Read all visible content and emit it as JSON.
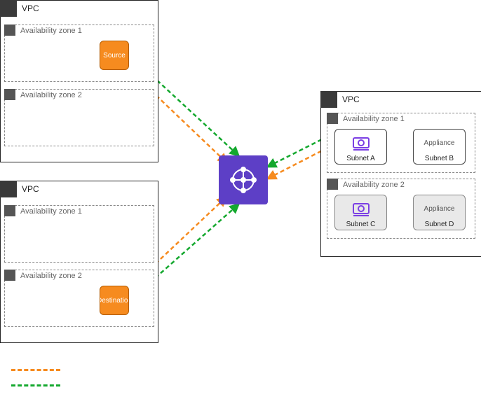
{
  "left_vpc_top": {
    "title": "VPC",
    "az1": "Availability zone 1",
    "az2": "Availability zone 2",
    "source_label": "Source"
  },
  "left_vpc_bottom": {
    "title": "VPC",
    "az1": "Availability zone 1",
    "az2": "Availability zone 2",
    "dest_label": "Destination"
  },
  "right_vpc": {
    "title": "VPC",
    "az1": "Availability zone 1",
    "az2": "Availability zone 2",
    "subnetA": "Subnet A",
    "subnetB": "Subnet B",
    "subnetC": "Subnet C",
    "subnetD": "Subnet D",
    "appliance": "Appliance"
  },
  "legend": {
    "orange": "",
    "green": ""
  }
}
